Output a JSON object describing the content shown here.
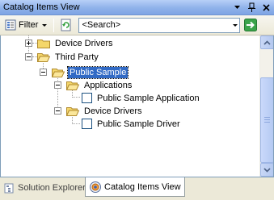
{
  "window": {
    "title": "Catalog Items View"
  },
  "toolbar": {
    "filter_label": "Filter",
    "search": {
      "value": "<Search>"
    }
  },
  "tree": {
    "items": [
      {
        "label": "Device Drivers",
        "state": "collapsed",
        "kind": "folder"
      },
      {
        "label": "Third Party",
        "state": "expanded",
        "kind": "folder"
      },
      {
        "label": "Public Sample",
        "state": "expanded",
        "kind": "folder",
        "selected": true
      },
      {
        "label": "Applications",
        "state": "expanded",
        "kind": "folder"
      },
      {
        "label": "Public Sample Application",
        "kind": "item",
        "checked": false
      },
      {
        "label": "Device Drivers",
        "state": "expanded",
        "kind": "folder"
      },
      {
        "label": "Public Sample Driver",
        "kind": "item",
        "checked": false
      }
    ]
  },
  "tabs": [
    {
      "label": "Solution Explorer",
      "active": false
    },
    {
      "label": "Catalog Items View",
      "active": true
    }
  ],
  "colors": {
    "selection": "#316ac5",
    "folder": "#f4d66a",
    "titlebar": "#8fb2ea"
  }
}
